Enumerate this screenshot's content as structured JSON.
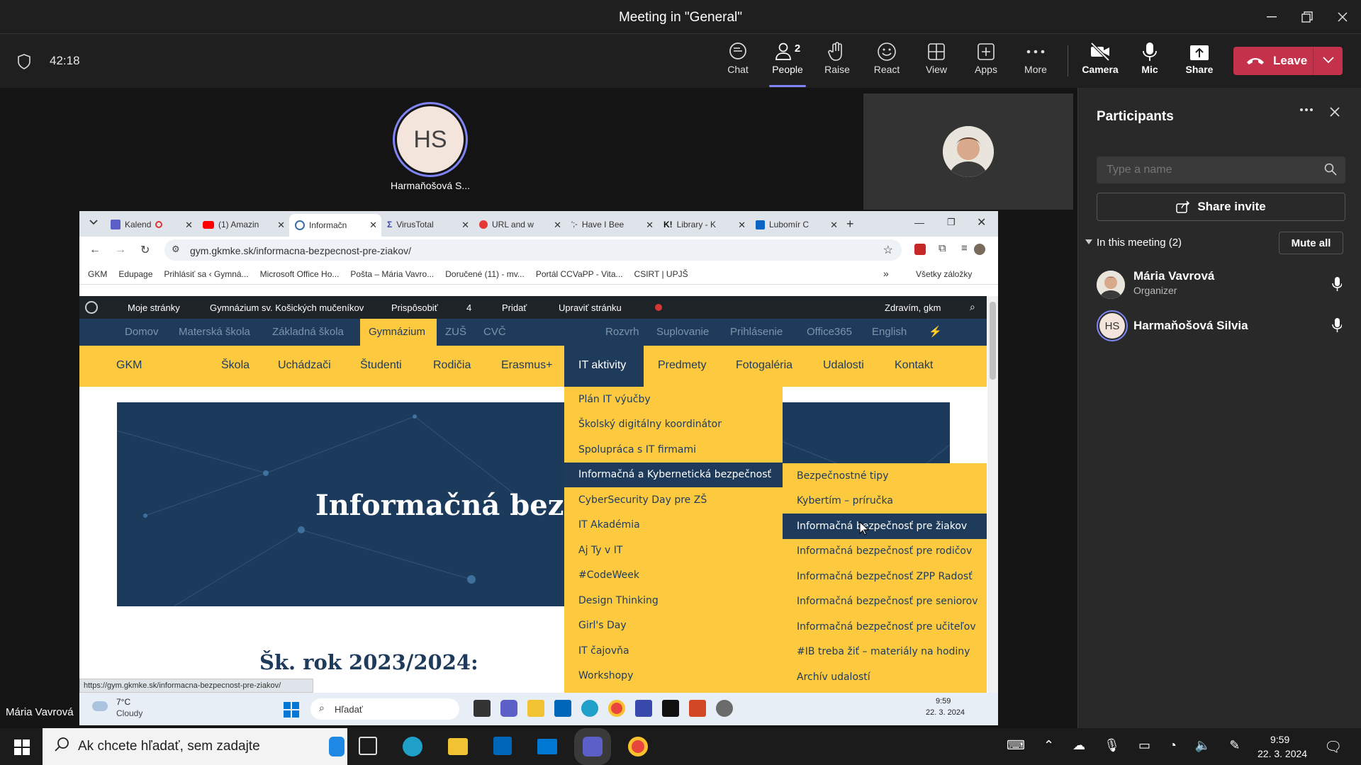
{
  "window": {
    "title": "Meeting in \"General\""
  },
  "meeting": {
    "timer": "42:18",
    "people_count": "2"
  },
  "toolbar": [
    {
      "label": "Chat",
      "icon": "chat-icon"
    },
    {
      "label": "People",
      "icon": "people-icon"
    },
    {
      "label": "Raise",
      "icon": "raise-hand-icon"
    },
    {
      "label": "React",
      "icon": "react-icon"
    },
    {
      "label": "View",
      "icon": "view-icon"
    },
    {
      "label": "Apps",
      "icon": "apps-icon"
    },
    {
      "label": "More",
      "icon": "more-icon"
    },
    {
      "label": "Camera",
      "icon": "camera-off-icon"
    },
    {
      "label": "Mic",
      "icon": "mic-icon"
    },
    {
      "label": "Share",
      "icon": "share-icon"
    }
  ],
  "leave_label": "Leave",
  "stage": {
    "tile_initials": "HS",
    "tile_name": "Harmaňošová S...",
    "presenter_name": "Mária Vavrová"
  },
  "panel": {
    "title": "Participants",
    "search_placeholder": "Type a name",
    "share_invite": "Share invite",
    "in_meeting": "In this meeting (2)",
    "mute_all": "Mute all",
    "participants": [
      {
        "name": "Mária Vavrová",
        "role": "Organizer",
        "initials": ""
      },
      {
        "name": "Harmaňošová Silvia",
        "role": "",
        "initials": "HS"
      }
    ]
  },
  "browser": {
    "tabs": [
      "Kalend",
      "(1) Amazin",
      "Informačn",
      "VirusTotal",
      "URL and w",
      "Have I Bee",
      "Library - K",
      "Lubomír C"
    ],
    "url": "gym.gkmke.sk/informacna-bezpecnost-pre-ziakov/",
    "bookmarks": [
      "GKM",
      "Edupage",
      "Prihlásiť sa ‹ Gymná...",
      "Microsoft Office Ho...",
      "Pošta – Mária Vavro...",
      "Doručené (11) - mv...",
      "Portál CCVaPP - Vita...",
      "CSIRT | UPJŠ"
    ],
    "all_bookmarks": "Všetky záložky",
    "status_url": "https://gym.gkmke.sk/informacna-bezpecnost-pre-ziakov/"
  },
  "wpbar": {
    "my_sites": "Moje stránky",
    "site": "Gymnázium sv. Košických mučeníkov",
    "customize": "Prispôsobiť",
    "comments": "4",
    "add": "Pridať",
    "edit": "Upraviť stránku",
    "greeting": "Zdravím, gkm"
  },
  "sitenav": {
    "left": [
      "Domov",
      "Materská škola",
      "Základná škola",
      "Gymnázium",
      "ZUŠ",
      "CVČ"
    ],
    "right": [
      "Rozvrh",
      "Suplovanie",
      "Prihlásenie",
      "Office365",
      "English"
    ],
    "active": "Gymnázium"
  },
  "mainnav": {
    "brand": "GKM",
    "items": [
      "Škola",
      "Uchádzači",
      "Študenti",
      "Rodičia",
      "Erasmus+",
      "IT aktivity",
      "Predmety",
      "Fotogaléria",
      "Udalosti",
      "Kontakt"
    ],
    "active": "IT aktivity"
  },
  "hero": {
    "title": "Informačná bezpečn"
  },
  "content": {
    "school_year": "Šk. rok 2023/2024:"
  },
  "dropdown1": [
    "Plán IT výučby",
    "Školský digitálny koordinátor",
    "Spolupráca s IT firmami",
    "Informačná a Kybernetická bezpečnosť",
    "CyberSecurity Day pre ZŠ",
    "IT Akadémia",
    "Aj Ty v IT",
    "#CodeWeek",
    "Design Thinking",
    "Girl's Day",
    "IT čajovňa",
    "Workshopy"
  ],
  "dropdown2": [
    "Bezpečnostné tipy",
    "Kybertím – príručka",
    "Informačná bezpečnosť pre žiakov",
    "Informačná bezpečnosť pre rodičov",
    "Informačná bezpečnosť ZPP Radosť",
    "Informačná bezpečnosť pre seniorov",
    "Informačná bezpečnosť pre učiteľov",
    "#IB treba žiť – materiály na hodiny",
    "Archív udalostí"
  ],
  "remote_taskbar": {
    "temp": "7°C",
    "weather": "Cloudy",
    "search": "Hľadať",
    "time": "9:59",
    "date": "22. 3. 2024"
  },
  "host_taskbar": {
    "search": "Ak chcete hľadať, sem zadajte",
    "time": "9:59",
    "date": "22. 3. 2024"
  },
  "colors": {
    "leave": "#c4314b",
    "accent": "#7f85f5",
    "nav_yellow": "#fcc93f",
    "nav_blue": "#1f3b5c"
  }
}
